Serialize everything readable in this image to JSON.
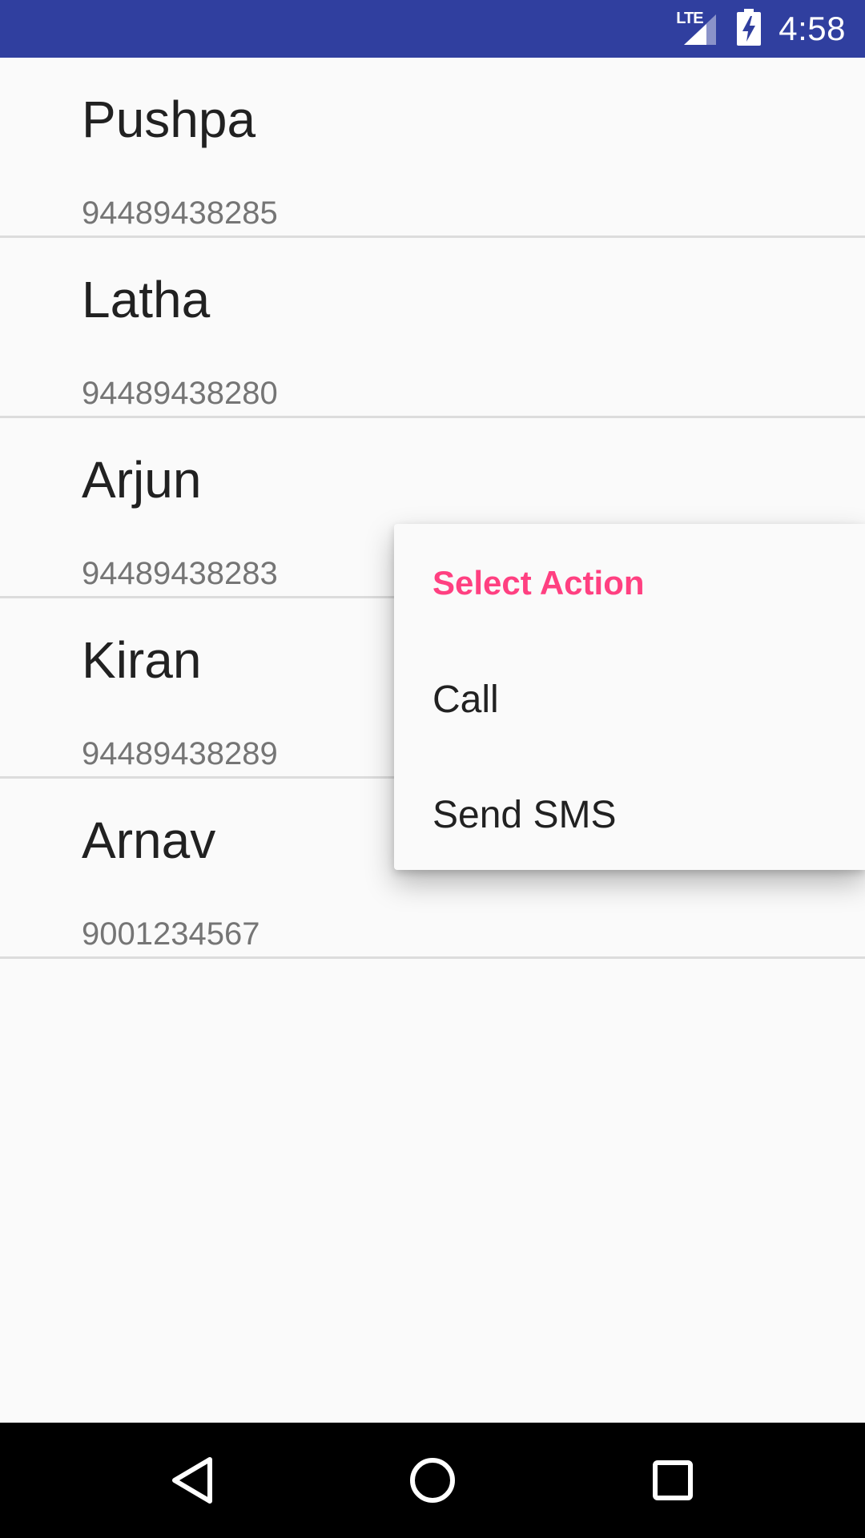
{
  "status_bar": {
    "network_label": "LTE",
    "time": "4:58",
    "icons": [
      "lte-signal-icon",
      "battery-charging-icon"
    ]
  },
  "contacts": [
    {
      "name": "Pushpa",
      "number": "94489438285"
    },
    {
      "name": "Latha",
      "number": "94489438280"
    },
    {
      "name": "Arjun",
      "number": "94489438283"
    },
    {
      "name": "Kiran",
      "number": "94489438289"
    },
    {
      "name": "Arnav",
      "number": "9001234567"
    }
  ],
  "context_menu": {
    "title": "Select Action",
    "items": [
      "Call",
      "Send SMS"
    ]
  },
  "nav_bar": {
    "icons": [
      "back-icon",
      "home-icon",
      "recents-icon"
    ]
  },
  "colors": {
    "status_bar": "#303f9f",
    "menu_title": "#ff4081",
    "background": "#fafafa"
  }
}
